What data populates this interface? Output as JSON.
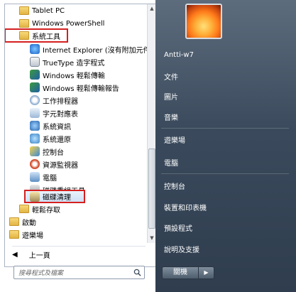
{
  "program_list": [
    {
      "label": "Tablet PC",
      "icon": "folder-icon",
      "type": "folder"
    },
    {
      "label": "Windows PowerShell",
      "icon": "folder-icon",
      "type": "folder"
    },
    {
      "label": "系統工具",
      "icon": "folder-icon",
      "type": "folder",
      "highlighted": true
    },
    {
      "label": "Internet Explorer (沒有附加元件",
      "icon": "internet-explorer-icon",
      "type": "app"
    },
    {
      "label": "TrueType 造字程式",
      "icon": "private-character-editor-icon",
      "type": "app"
    },
    {
      "label": "Windows 輕鬆傳輸",
      "icon": "windows-easy-transfer-icon",
      "type": "app"
    },
    {
      "label": "Windows 輕鬆傳輸報告",
      "icon": "windows-easy-transfer-reports-icon",
      "type": "app"
    },
    {
      "label": "工作排程器",
      "icon": "task-scheduler-icon",
      "type": "app"
    },
    {
      "label": "字元對應表",
      "icon": "character-map-icon",
      "type": "app"
    },
    {
      "label": "系統資訊",
      "icon": "system-information-icon",
      "type": "app"
    },
    {
      "label": "系統還原",
      "icon": "system-restore-icon",
      "type": "app"
    },
    {
      "label": "控制台",
      "icon": "control-panel-icon",
      "type": "app"
    },
    {
      "label": "資源監視器",
      "icon": "resource-monitor-icon",
      "type": "app"
    },
    {
      "label": "電腦",
      "icon": "computer-icon",
      "type": "app"
    },
    {
      "label": "磁碟重組工具",
      "icon": "disk-defragmenter-icon",
      "type": "app"
    },
    {
      "label": "磁碟清理",
      "icon": "disk-cleanup-icon",
      "type": "app",
      "highlighted": true,
      "selected": true
    },
    {
      "label": "輕鬆存取",
      "icon": "folder-icon",
      "type": "folder"
    },
    {
      "label": "啟動",
      "icon": "folder-icon",
      "type": "folder"
    },
    {
      "label": "遊樂場",
      "icon": "folder-icon",
      "type": "folder"
    }
  ],
  "back_label": "上一頁",
  "search": {
    "placeholder": "搜尋程式及檔案"
  },
  "right_items": [
    "Antti-w7",
    "文件",
    "圖片",
    "音樂",
    "遊樂場",
    "電腦",
    "控制台",
    "裝置和印表機",
    "預設程式",
    "說明及支援"
  ],
  "shutdown_label": "關機",
  "colors": {
    "highlight": "#d42020",
    "right_panel": "#3a4a5c",
    "folder": "#e2b445"
  }
}
